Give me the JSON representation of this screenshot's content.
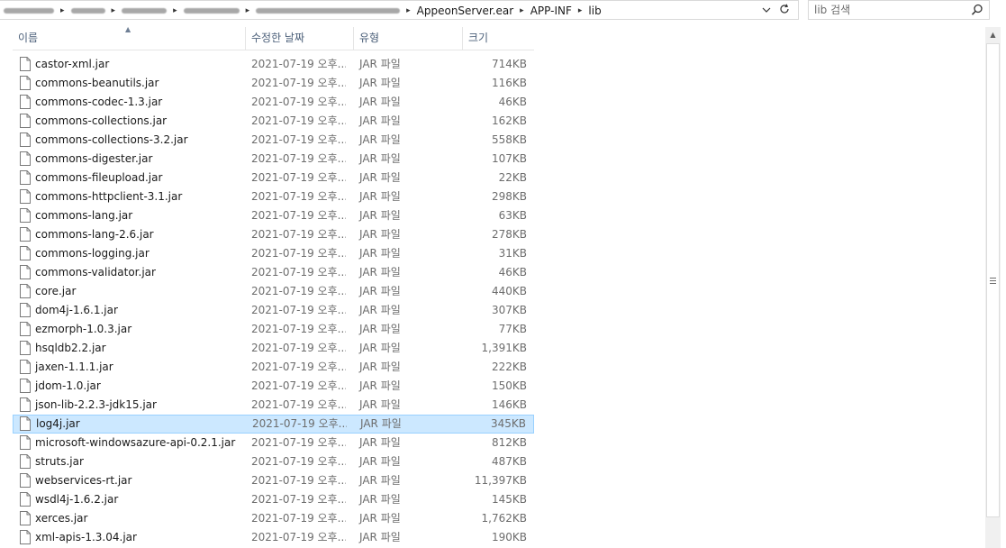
{
  "address": {
    "crumbs": [
      "AppeonServer.ear",
      "APP-INF",
      "lib"
    ],
    "dropdown_icon": "chevron-down-icon",
    "refresh_icon": "refresh-icon"
  },
  "search": {
    "placeholder": "lib 검색",
    "icon": "search-icon"
  },
  "columns": {
    "name": "이름",
    "date": "수정한 날짜",
    "type": "유형",
    "size": "크기"
  },
  "files": [
    {
      "name": "castor-xml.jar",
      "date": "2021-07-19 오후...",
      "type": "JAR 파일",
      "size": "714KB"
    },
    {
      "name": "commons-beanutils.jar",
      "date": "2021-07-19 오후...",
      "type": "JAR 파일",
      "size": "116KB"
    },
    {
      "name": "commons-codec-1.3.jar",
      "date": "2021-07-19 오후...",
      "type": "JAR 파일",
      "size": "46KB"
    },
    {
      "name": "commons-collections.jar",
      "date": "2021-07-19 오후...",
      "type": "JAR 파일",
      "size": "162KB"
    },
    {
      "name": "commons-collections-3.2.jar",
      "date": "2021-07-19 오후...",
      "type": "JAR 파일",
      "size": "558KB"
    },
    {
      "name": "commons-digester.jar",
      "date": "2021-07-19 오후...",
      "type": "JAR 파일",
      "size": "107KB"
    },
    {
      "name": "commons-fileupload.jar",
      "date": "2021-07-19 오후...",
      "type": "JAR 파일",
      "size": "22KB"
    },
    {
      "name": "commons-httpclient-3.1.jar",
      "date": "2021-07-19 오후...",
      "type": "JAR 파일",
      "size": "298KB"
    },
    {
      "name": "commons-lang.jar",
      "date": "2021-07-19 오후...",
      "type": "JAR 파일",
      "size": "63KB"
    },
    {
      "name": "commons-lang-2.6.jar",
      "date": "2021-07-19 오후...",
      "type": "JAR 파일",
      "size": "278KB"
    },
    {
      "name": "commons-logging.jar",
      "date": "2021-07-19 오후...",
      "type": "JAR 파일",
      "size": "31KB"
    },
    {
      "name": "commons-validator.jar",
      "date": "2021-07-19 오후...",
      "type": "JAR 파일",
      "size": "46KB"
    },
    {
      "name": "core.jar",
      "date": "2021-07-19 오후...",
      "type": "JAR 파일",
      "size": "440KB"
    },
    {
      "name": "dom4j-1.6.1.jar",
      "date": "2021-07-19 오후...",
      "type": "JAR 파일",
      "size": "307KB"
    },
    {
      "name": "ezmorph-1.0.3.jar",
      "date": "2021-07-19 오후...",
      "type": "JAR 파일",
      "size": "77KB"
    },
    {
      "name": "hsqldb2.2.jar",
      "date": "2021-07-19 오후...",
      "type": "JAR 파일",
      "size": "1,391KB"
    },
    {
      "name": "jaxen-1.1.1.jar",
      "date": "2021-07-19 오후...",
      "type": "JAR 파일",
      "size": "222KB"
    },
    {
      "name": "jdom-1.0.jar",
      "date": "2021-07-19 오후...",
      "type": "JAR 파일",
      "size": "150KB"
    },
    {
      "name": "json-lib-2.2.3-jdk15.jar",
      "date": "2021-07-19 오후...",
      "type": "JAR 파일",
      "size": "146KB"
    },
    {
      "name": "log4j.jar",
      "date": "2021-07-19 오후...",
      "type": "JAR 파일",
      "size": "345KB",
      "selected": true
    },
    {
      "name": "microsoft-windowsazure-api-0.2.1.jar",
      "date": "2021-07-19 오후...",
      "type": "JAR 파일",
      "size": "812KB"
    },
    {
      "name": "struts.jar",
      "date": "2021-07-19 오후...",
      "type": "JAR 파일",
      "size": "487KB"
    },
    {
      "name": "webservices-rt.jar",
      "date": "2021-07-19 오후...",
      "type": "JAR 파일",
      "size": "11,397KB"
    },
    {
      "name": "wsdl4j-1.6.2.jar",
      "date": "2021-07-19 오후...",
      "type": "JAR 파일",
      "size": "145KB"
    },
    {
      "name": "xerces.jar",
      "date": "2021-07-19 오후...",
      "type": "JAR 파일",
      "size": "1,762KB"
    },
    {
      "name": "xml-apis-1.3.04.jar",
      "date": "2021-07-19 오후...",
      "type": "JAR 파일",
      "size": "190KB"
    }
  ],
  "colors": {
    "selected_bg": "#cce8ff",
    "selected_border": "#99d1ff",
    "header_text": "#4c607a"
  }
}
